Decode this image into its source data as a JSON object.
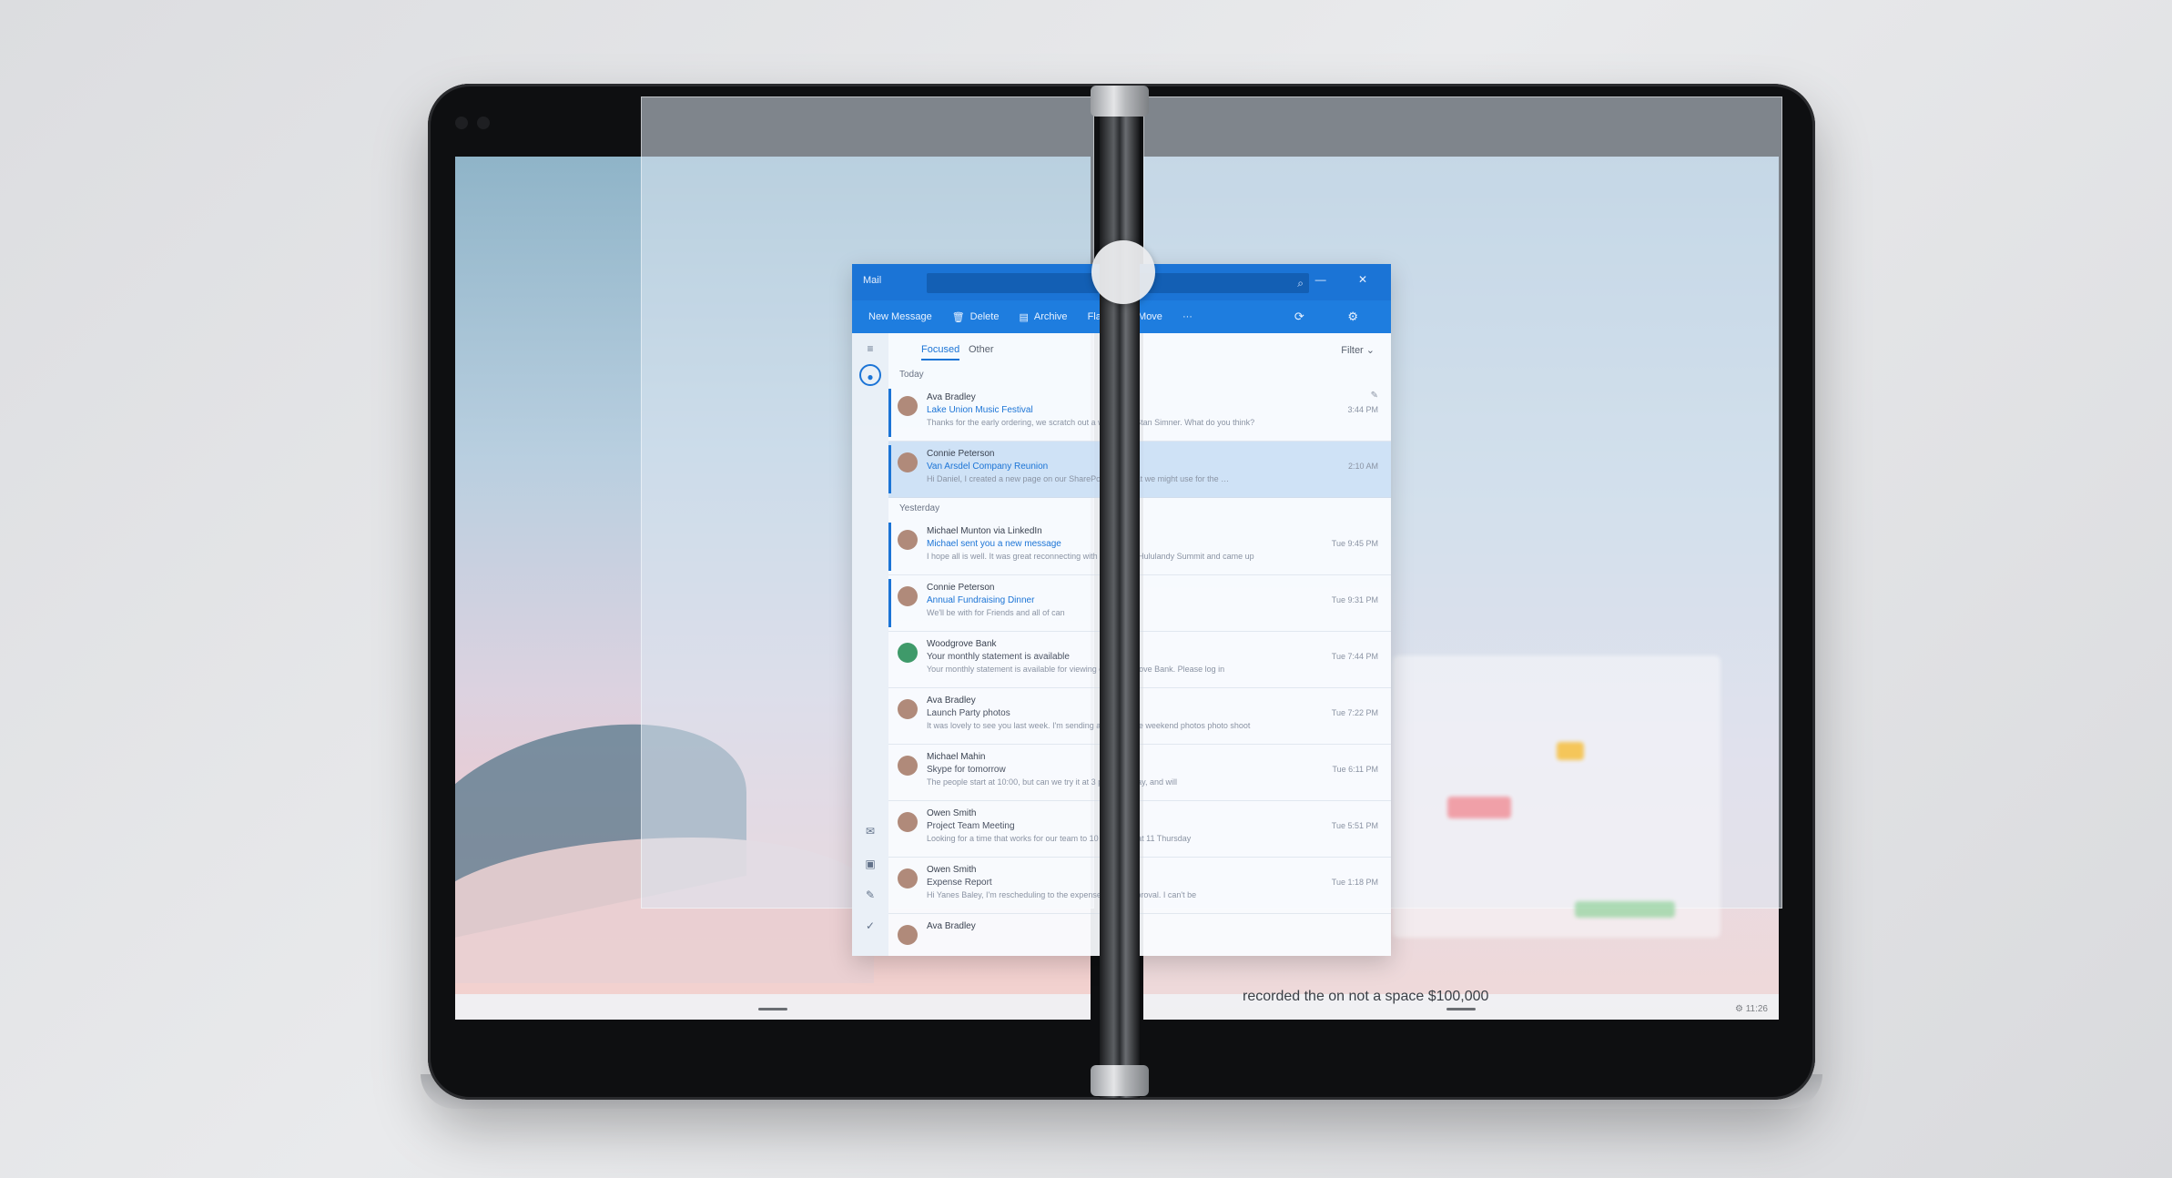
{
  "mail": {
    "app_name": "Mail",
    "window_controls": "— ✕",
    "toolbar": {
      "new_message": "New Message",
      "delete": "Delete",
      "archive": "Archive",
      "flag": "Flag",
      "move": "Move",
      "more": "···",
      "sync_settings": "⟳ ⚙"
    },
    "tabs": {
      "focused": "Focused",
      "other": "Other",
      "filter": "Filter ⌄"
    },
    "groups": {
      "today": "Today",
      "yesterday": "Yesterday"
    },
    "messages": [
      {
        "sender": "Ava Bradley",
        "subject": "Lake Union Music Festival",
        "preview": "Thanks for the early ordering, we scratch out a weekend. Stan Simner. What do you think?",
        "time": "3:44 PM",
        "unread": true,
        "selected": false
      },
      {
        "sender": "Connie Peterson",
        "subject": "Van Arsdel Company Reunion",
        "preview": "Hi Daniel, I created a new page on our SharePoint site, that we might use for the …",
        "time": "2:10 AM",
        "unread": true,
        "selected": true
      },
      {
        "sender": "Michael Munton via LinkedIn",
        "subject": "Michael sent you a new message",
        "preview": "I hope all is well. It was great reconnecting with you at the Hululandy Summit and came up",
        "time": "Tue 9:45 PM",
        "unread": true,
        "selected": false
      },
      {
        "sender": "Connie Peterson",
        "subject": "Annual Fundraising Dinner",
        "preview": "We'll be with for Friends and all of can",
        "time": "Tue 9:31 PM",
        "unread": true,
        "selected": false
      },
      {
        "sender": "Woodgrove Bank",
        "subject": "Your monthly statement is available",
        "preview": "Your monthly statement is available for viewing on Woodgrove Bank. Please log in",
        "time": "Tue 7:44 PM",
        "unread": false,
        "selected": false
      },
      {
        "sender": "Ava Bradley",
        "subject": "Launch Party photos",
        "preview": "It was lovely to see you last week. I'm sending a copy of the weekend photos photo shoot",
        "time": "Tue 7:22 PM",
        "unread": false,
        "selected": false
      },
      {
        "sender": "Michael Mahin",
        "subject": "Skype for tomorrow",
        "preview": "The people start at 10:00, but can we try it at 3 pm on Friday, and will",
        "time": "Tue 6:11 PM",
        "unread": false,
        "selected": false
      },
      {
        "sender": "Owen Smith",
        "subject": "Project Team Meeting",
        "preview": "Looking for a time that works for our team to 10 tomorrow at 11 Thursday",
        "time": "Tue 5:51 PM",
        "unread": false,
        "selected": false
      },
      {
        "sender": "Owen Smith",
        "subject": "Expense Report",
        "preview": "Hi Yanes Baley, I'm rescheduling to the expense report approval. I can't be",
        "time": "Tue 1:18 PM",
        "unread": false,
        "selected": false
      },
      {
        "sender": "Ava Bradley",
        "subject": "",
        "preview": "",
        "time": "",
        "unread": false,
        "selected": false
      }
    ]
  },
  "background_window": {
    "caption": "recorded the on not a space $100,000"
  },
  "taskbar": {
    "tray": "⚙ 11:26"
  },
  "colors": {
    "accent": "#1b74d6",
    "device_bezel": "#0e0f11"
  },
  "icons": [
    "search-icon",
    "delete-icon",
    "archive-icon",
    "move-icon",
    "sync-icon",
    "settings-icon",
    "menu-icon",
    "mail-icon",
    "calendar-icon",
    "people-icon",
    "todo-icon",
    "pin-icon"
  ]
}
